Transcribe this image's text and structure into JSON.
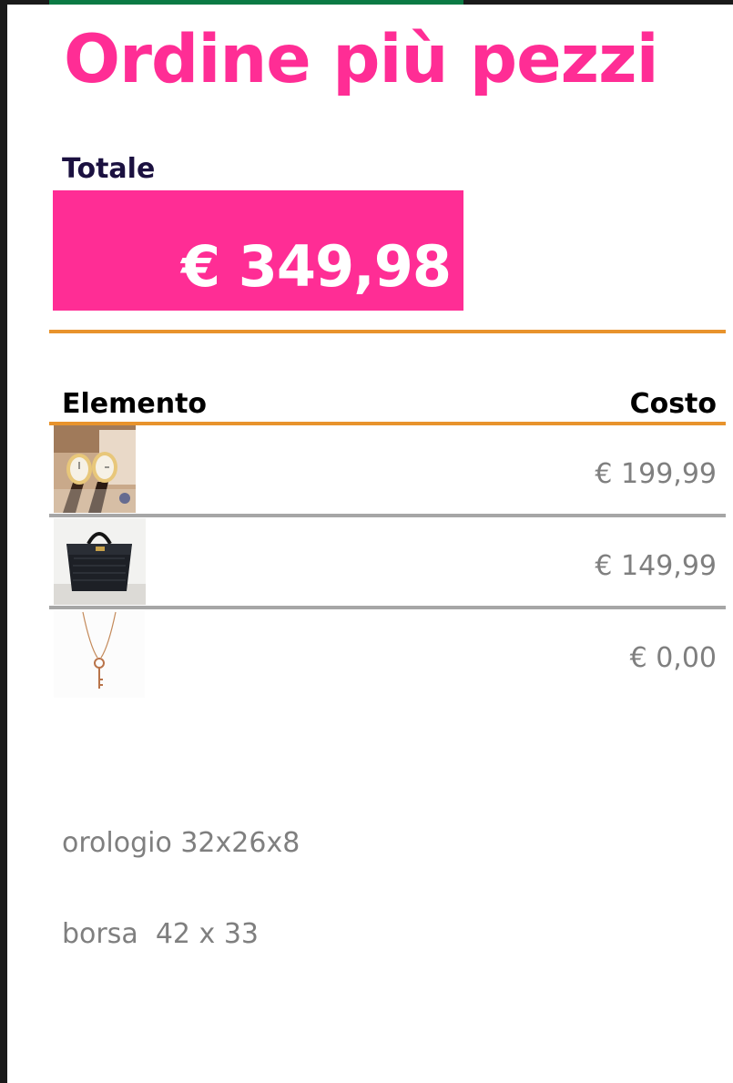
{
  "title": "Ordine più pezzi",
  "total": {
    "label": "Totale",
    "value": "€ 349,98"
  },
  "table": {
    "columns": [
      "Elemento",
      "Costo"
    ],
    "rows": [
      {
        "image": "watch-image",
        "cost": "€ 199,99"
      },
      {
        "image": "handbag-image",
        "cost": "€ 149,99"
      },
      {
        "image": "necklace-image",
        "cost": "€ 0,00"
      }
    ]
  },
  "notes": [
    "orologio 32x26x8",
    "borsa  42 x 33"
  ],
  "colors": {
    "accent_pink": "#ff2d95",
    "rule_orange": "#e8932c",
    "rule_gray": "#a6a6a6",
    "header_bar_green": "#0b7a44",
    "label_navy": "#1b1140",
    "muted_text": "#7f7f7f"
  }
}
